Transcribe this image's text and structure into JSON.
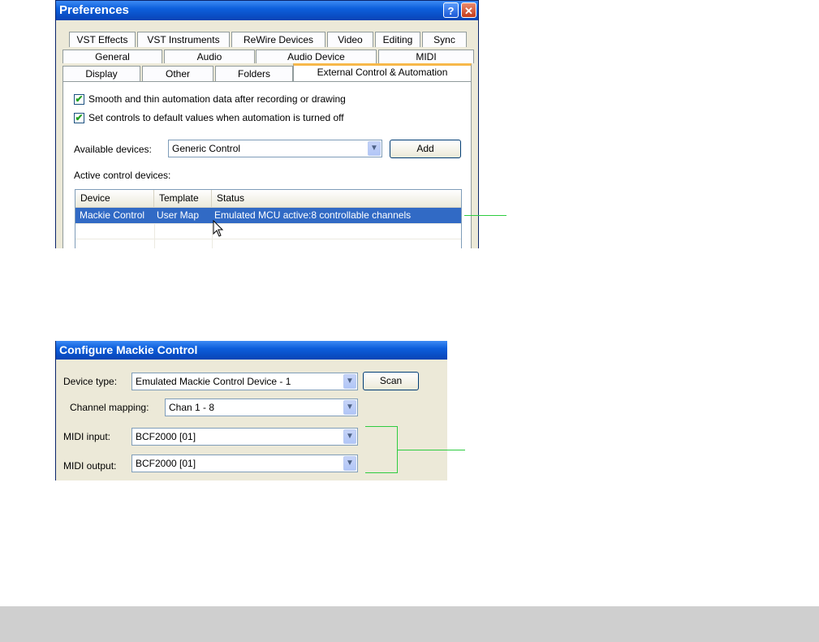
{
  "preferences": {
    "title": "Preferences",
    "help_label": "?",
    "close_label": "✕",
    "tabs_row1": [
      "VST Effects",
      "VST Instruments",
      "ReWire Devices",
      "Video",
      "Editing",
      "Sync"
    ],
    "tabs_row2": [
      "General",
      "Audio",
      "Audio Device",
      "MIDI"
    ],
    "tabs_row3": [
      "Display",
      "Other",
      "Folders",
      "External Control & Automation"
    ],
    "checkbox_smooth": {
      "label": "Smooth and thin automation data after recording or drawing",
      "checked": true
    },
    "checkbox_default": {
      "label": "Set controls to default values when automation is turned off",
      "checked": true
    },
    "available_devices_label": "Available devices:",
    "available_devices_value": "Generic Control",
    "add_button": "Add",
    "active_devices_label": "Active control devices:",
    "table": {
      "columns": [
        "Device",
        "Template",
        "Status"
      ],
      "rows": [
        {
          "device": "Mackie Control",
          "template": "User Map",
          "status": "Emulated MCU active:8 controllable channels",
          "selected": true
        }
      ]
    }
  },
  "configure": {
    "title": "Configure Mackie Control",
    "device_type_label": "Device type:",
    "device_type_value": "Emulated Mackie Control Device - 1",
    "scan_button": "Scan",
    "channel_mapping_label": "Channel mapping:",
    "channel_mapping_value": "Chan 1 - 8",
    "midi_input_label": "MIDI input:",
    "midi_input_value": "BCF2000 [01]",
    "midi_output_label": "MIDI output:",
    "midi_output_value": "BCF2000 [01]"
  },
  "icons": {
    "dropdown_arrow": "chevron-down-icon",
    "cursor": "mouse-pointer-icon",
    "checkmark": "checkmark-icon"
  },
  "colors": {
    "title_blue": "#0a4fc6",
    "selection_blue": "#316ac5",
    "active_tab_accent": "#f7b84a",
    "annotation_green": "#2ecc40",
    "footer_gray": "#cfcfcf"
  }
}
